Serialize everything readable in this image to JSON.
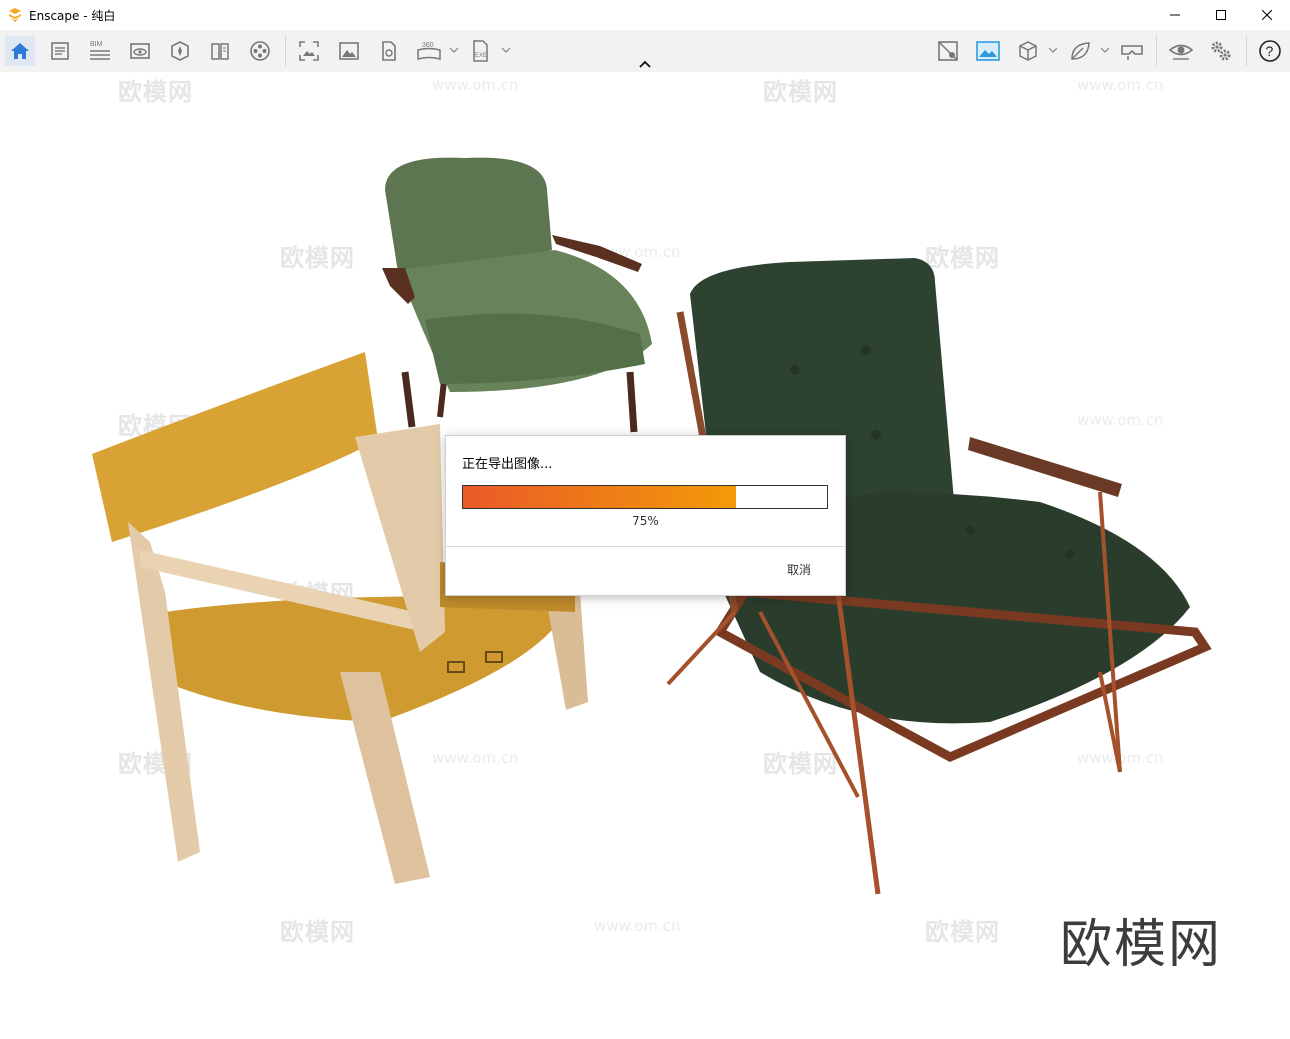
{
  "window": {
    "title": "Enscape - 纯白",
    "accent": "#2f7bd9",
    "logo_color": "#f5a623"
  },
  "toolbar": {
    "left_icons": [
      "home-icon",
      "document-icon",
      "bim-icon",
      "view-icon",
      "asset-library-icon",
      "book-icon",
      "video-reel-icon"
    ],
    "mid_icons": [
      "screenshot-icon",
      "image-icon",
      "export-file-icon",
      "panorama-360-icon",
      "exe-export-icon"
    ],
    "right_icons": [
      "material-icon",
      "sky-icon",
      "cube-icon",
      "leaf-icon",
      "vr-headset-icon",
      "eye-icon",
      "settings-gear-icon",
      "help-icon"
    ],
    "bim_label": "BIM",
    "pano_label": "360",
    "exe_label": "EXE"
  },
  "watermarks": {
    "cn": "欧模网",
    "url": "www.om.cn",
    "brand": "欧模网"
  },
  "dialog": {
    "title": "正在导出图像...",
    "progress_percent": 75,
    "progress_label": "75%",
    "cancel_label": "取消",
    "colors": {
      "fill_start": "#ea5a28",
      "fill_end": "#f29a08"
    }
  }
}
